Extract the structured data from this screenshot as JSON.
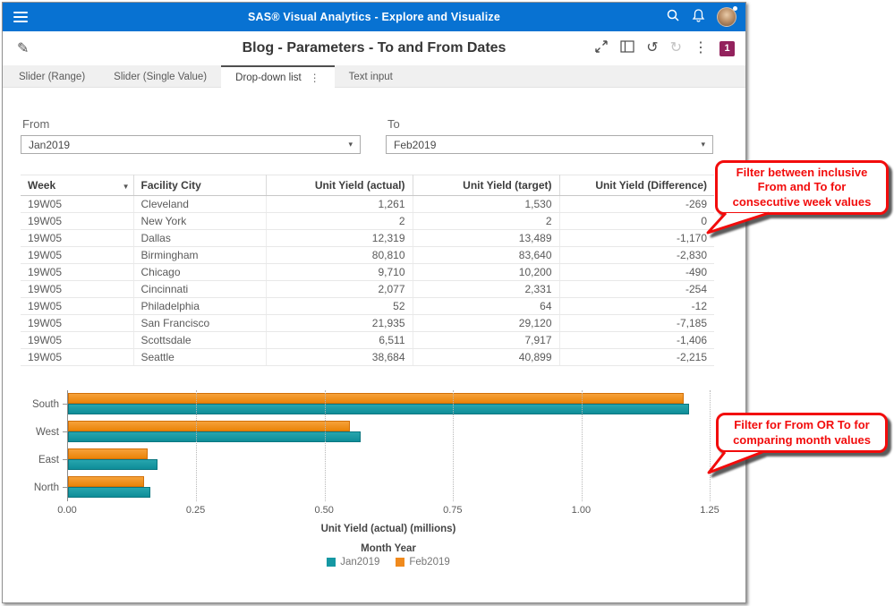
{
  "app_bar": {
    "title": "SAS® Visual Analytics - Explore and Visualize"
  },
  "toolbar": {
    "title": "Blog - Parameters - To and From Dates",
    "badge_count": "1",
    "undo_glyph": "↺",
    "redo_glyph": "↻",
    "kebab_glyph": "⋮",
    "pencil_glyph": "✎"
  },
  "tabs": [
    {
      "label": "Slider (Range)",
      "active": false
    },
    {
      "label": "Slider (Single Value)",
      "active": false
    },
    {
      "label": "Drop-down list",
      "active": true
    },
    {
      "label": "Text input",
      "active": false
    }
  ],
  "filters": {
    "from": {
      "label": "From",
      "value": "Jan2019"
    },
    "to": {
      "label": "To",
      "value": "Feb2019"
    }
  },
  "table": {
    "columns": [
      {
        "label": "Week",
        "align": "left",
        "filter": true
      },
      {
        "label": "Facility City",
        "align": "left"
      },
      {
        "label": "Unit Yield (actual)",
        "align": "right"
      },
      {
        "label": "Unit Yield (target)",
        "align": "right"
      },
      {
        "label": "Unit Yield (Difference)",
        "align": "right"
      }
    ],
    "rows": [
      [
        "19W05",
        "Cleveland",
        "1,261",
        "1,530",
        "-269"
      ],
      [
        "19W05",
        "New York",
        "2",
        "2",
        "0"
      ],
      [
        "19W05",
        "Dallas",
        "12,319",
        "13,489",
        "-1,170"
      ],
      [
        "19W05",
        "Birmingham",
        "80,810",
        "83,640",
        "-2,830"
      ],
      [
        "19W05",
        "Chicago",
        "9,710",
        "10,200",
        "-490"
      ],
      [
        "19W05",
        "Cincinnati",
        "2,077",
        "2,331",
        "-254"
      ],
      [
        "19W05",
        "Philadelphia",
        "52",
        "64",
        "-12"
      ],
      [
        "19W05",
        "San Francisco",
        "21,935",
        "29,120",
        "-7,185"
      ],
      [
        "19W05",
        "Scottsdale",
        "6,511",
        "7,917",
        "-1,406"
      ],
      [
        "19W05",
        "Seattle",
        "38,684",
        "40,899",
        "-2,215"
      ]
    ]
  },
  "chart_data": {
    "type": "bar",
    "orientation": "horizontal",
    "categories": [
      "South",
      "West",
      "East",
      "North"
    ],
    "series": [
      {
        "name": "Jan2019",
        "color": "#1598a3",
        "values": [
          1.21,
          0.57,
          0.175,
          0.16
        ]
      },
      {
        "name": "Feb2019",
        "color": "#f08a1d",
        "values": [
          1.2,
          0.55,
          0.155,
          0.148
        ]
      }
    ],
    "bar_order_in_group_top_to_bottom": [
      "Feb2019",
      "Jan2019"
    ],
    "xlabel": "Unit Yield (actual) (millions)",
    "xticks": [
      "0.00",
      "0.25",
      "0.50",
      "0.75",
      "1.00",
      "1.25"
    ],
    "xlim": [
      0,
      1.25
    ],
    "grid": "dotted-vertical",
    "legend_title": "Month Year",
    "legend_position": "bottom"
  },
  "callouts": [
    {
      "text": "Filter between inclusive From and To for consecutive week values"
    },
    {
      "text": "Filter for From OR To for comparing month values"
    }
  ],
  "colors": {
    "app_bar_blue": "#0872d2",
    "badge_magenta": "#93225d",
    "teal": "#1598a3",
    "orange": "#f08a1d",
    "callout_red": "#f20c0c"
  }
}
